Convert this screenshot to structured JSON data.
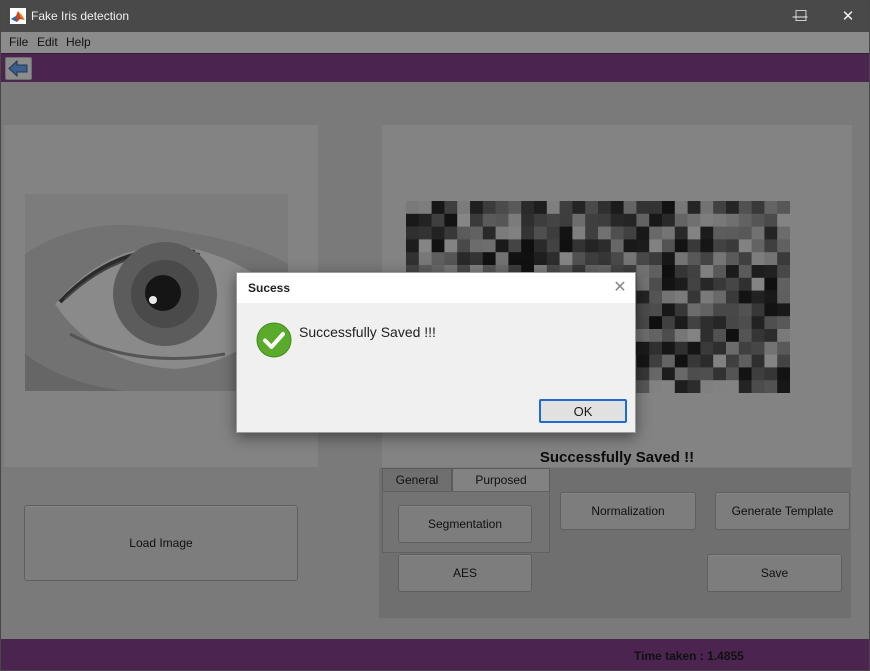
{
  "window": {
    "title": "Fake Iris detection",
    "minimize_glyph": "—",
    "maximize_glyph": "☐",
    "close_glyph": "✕"
  },
  "menu": {
    "items": [
      "File",
      "Edit",
      "Help"
    ]
  },
  "toolbar": {
    "back_icon": "back-arrow-icon"
  },
  "main": {
    "saved_label": "Successfully Saved !!",
    "tabs": [
      {
        "label": "General",
        "selected": false
      },
      {
        "label": "Purposed",
        "selected": true
      }
    ],
    "buttons": {
      "load_image": "Load Image",
      "segmentation": "Segmentation",
      "normalization": "Normalization",
      "generate_template": "Generate Template",
      "aes": "AES",
      "save": "Save"
    }
  },
  "status": {
    "time_label": "Time taken :",
    "time_value": "1.4855"
  },
  "dialog": {
    "title": "Sucess",
    "close_glyph": "✕",
    "message": "Successfully Saved !!!",
    "icon": "success-check-icon",
    "ok_label": "OK"
  },
  "colors": {
    "accent_purple": "#4b2450",
    "success_green": "#5aab2b",
    "ok_border": "#1e6ccf"
  }
}
